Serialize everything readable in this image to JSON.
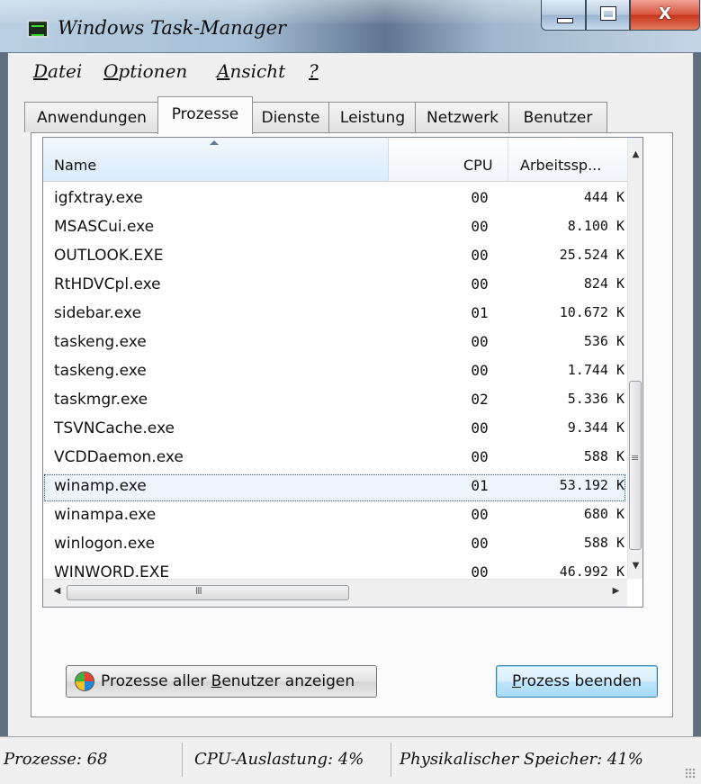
{
  "window": {
    "title": "Windows Task-Manager"
  },
  "title_buttons": {
    "minimize": "minimize",
    "maximize": "maximize",
    "close": "X"
  },
  "menu": {
    "datei": "Datei",
    "optionen": "Optionen",
    "ansicht": "Ansicht",
    "help": "?"
  },
  "tabs": [
    "Anwendungen",
    "Prozesse",
    "Dienste",
    "Leistung",
    "Netzwerk",
    "Benutzer"
  ],
  "active_tab": "Prozesse",
  "table": {
    "columns": {
      "name": "Name",
      "cpu": "CPU",
      "mem": "Arbeitssp..."
    },
    "rows": [
      {
        "name": "igfxtray.exe",
        "cpu": "00",
        "mem": "444 K"
      },
      {
        "name": "MSASCui.exe",
        "cpu": "00",
        "mem": "8.100 K"
      },
      {
        "name": "OUTLOOK.EXE",
        "cpu": "00",
        "mem": "25.524 K"
      },
      {
        "name": "RtHDVCpl.exe",
        "cpu": "00",
        "mem": "824 K"
      },
      {
        "name": "sidebar.exe",
        "cpu": "01",
        "mem": "10.672 K"
      },
      {
        "name": "taskeng.exe",
        "cpu": "00",
        "mem": "536 K"
      },
      {
        "name": "taskeng.exe",
        "cpu": "00",
        "mem": "1.744 K"
      },
      {
        "name": "taskmgr.exe",
        "cpu": "02",
        "mem": "5.336 K"
      },
      {
        "name": "TSVNCache.exe",
        "cpu": "00",
        "mem": "9.344 K"
      },
      {
        "name": "VCDDaemon.exe",
        "cpu": "00",
        "mem": "588 K"
      },
      {
        "name": "winamp.exe",
        "cpu": "01",
        "mem": "53.192 K"
      },
      {
        "name": "winampa.exe",
        "cpu": "00",
        "mem": "680 K"
      },
      {
        "name": "winlogon.exe",
        "cpu": "00",
        "mem": "588 K"
      },
      {
        "name": "WINWORD.EXE",
        "cpu": "00",
        "mem": "46.992 K"
      }
    ],
    "selected_row": "winamp.exe"
  },
  "buttons": {
    "show_all_pre": "Prozesse aller ",
    "show_all_ul": "B",
    "show_all_post": "enutzer anzeigen",
    "end_ul": "P",
    "end_post": "rozess beenden"
  },
  "status": {
    "processes": "Prozesse: 68",
    "cpu": "CPU-Auslastung: 4%",
    "memory": "Physikalischer Speicher: 41%"
  },
  "icons": {
    "shield": "uac-shield-icon",
    "sort": "sort-ascending-icon"
  }
}
